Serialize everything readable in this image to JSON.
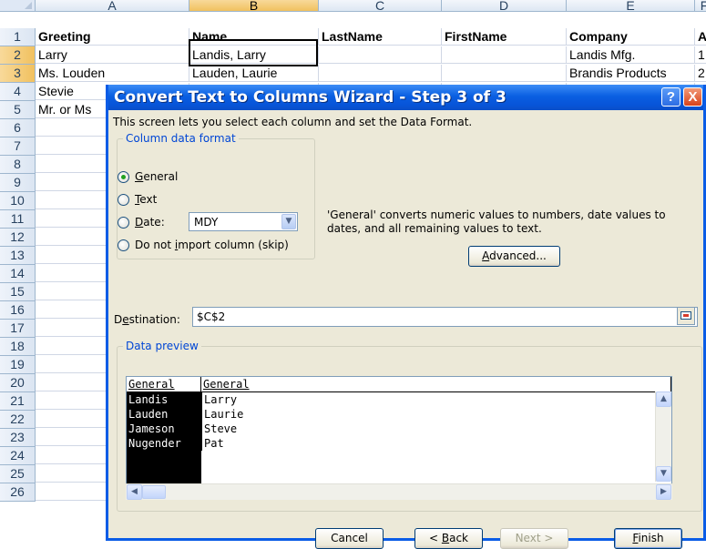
{
  "spreadsheet": {
    "columns": [
      "A",
      "B",
      "C",
      "D",
      "E",
      "F"
    ],
    "rows": [
      "1",
      "2",
      "3",
      "4",
      "5",
      "6",
      "7",
      "8",
      "9",
      "10",
      "11",
      "12",
      "13",
      "14",
      "15",
      "16",
      "17",
      "18",
      "19",
      "20",
      "21",
      "22",
      "23",
      "24",
      "25",
      "26"
    ],
    "cells": {
      "A1": "Greeting",
      "B1": "Name",
      "C1": "LastName",
      "D1": "FirstName",
      "E1": "Company",
      "F1": "A",
      "A2": "Larry",
      "B2": "Landis, Larry",
      "E2": "Landis Mfg.",
      "F2": "1",
      "A3": "Ms. Louden",
      "B3": "Lauden, Laurie",
      "E3": "Brandis Products",
      "F3": "2",
      "A4": "Stevie",
      "A5": "Mr. or Ms"
    }
  },
  "dialog": {
    "title": "Convert Text to Columns Wizard - Step 3 of 3",
    "help_button": "?",
    "close_button": "X",
    "description": "This screen lets you select each column and set the Data Format.",
    "column_data_format": {
      "legend": "Column data format",
      "general": "General",
      "text": "Text",
      "date": "Date:",
      "date_value": "MDY",
      "skip": "Do not import column (skip)",
      "selected": "general"
    },
    "explanation": "'General' converts numeric values to numbers, date values to dates, and all remaining values to text.",
    "advanced_button": "Advanced...",
    "destination_label": "Destination:",
    "destination_value": "$C$2",
    "data_preview": {
      "legend": "Data preview",
      "headers": [
        "General",
        "General"
      ],
      "rows": [
        [
          "Landis",
          "Larry"
        ],
        [
          "Lauden",
          "Laurie"
        ],
        [
          "Jameson",
          "Steve"
        ],
        [
          "Nugender",
          "Pat"
        ]
      ]
    },
    "buttons": {
      "cancel": "Cancel",
      "back": "< Back",
      "next": "Next >",
      "finish": "Finish"
    }
  }
}
